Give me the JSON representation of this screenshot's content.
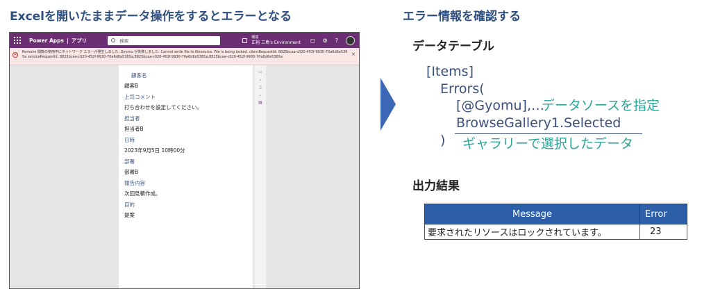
{
  "left_title": "Excelを開いたままデータ操作をするとエラーとなる",
  "right_title": "エラー情報を確認する",
  "app": {
    "name": "Power Apps",
    "separator": "|",
    "app_label": "アプリ",
    "search_placeholder": "検索",
    "env_label": "環境",
    "env_name": "正裕 三島's Environment",
    "icons": [
      "waffle-icon",
      "search-icon",
      "environment-icon",
      "bell-icon",
      "gear-icon",
      "help-icon",
      "avatar"
    ]
  },
  "error_banner": {
    "message": "Remove 関数の使用中にネットワーク エラーが発生しました: Gyomu が失敗しました: Cannot write file to filesource. File is being locked. clientRequestId: 8825bcaa-c020-452f-9930-70a6d6e5365a serviceRequestId: 8825bcaa-c020-452f-9930-70a6d6e5365a;8825bcaa-c020-452f-9930-70a6d6e5365a;8825bcaa-c020-452f-9930-70a6d6e5365a",
    "close": "×"
  },
  "form": {
    "fields": [
      {
        "label": "顧客名",
        "value": "顧客B"
      },
      {
        "label": "上司コメント",
        "value": "打ち合わせを設定してください。"
      },
      {
        "label": "担当者",
        "value": "担当者B"
      },
      {
        "label": "日時",
        "value": "2023年9月5日 10時00分"
      },
      {
        "label": "部署",
        "value": "部署B"
      },
      {
        "label": "報告内容",
        "value": "次回見積作成。"
      },
      {
        "label": "目的",
        "value": "提案"
      }
    ]
  },
  "datatable_heading": "データテーブル",
  "formula": {
    "items": "[Items]",
    "errors": "Errors(",
    "gyomu": "[@Gyomu],…",
    "gyomu_note": "データソースを指定",
    "browse": "BrowseGallery1.Selected",
    "close": ")",
    "browse_note": "ギャラリーで選択したデータ"
  },
  "output_heading": "出力結果",
  "result_table": {
    "headers": [
      "Message",
      "Error"
    ],
    "rows": [
      [
        "要求されたリソースはロックされています。",
        "23"
      ]
    ]
  },
  "colors": {
    "title": "#2f4f7f",
    "power_apps_bar": "#6b2e73",
    "accent_teal": "#2aa598",
    "table_header": "#2d5fa8",
    "arrow": "#3c67b5"
  }
}
